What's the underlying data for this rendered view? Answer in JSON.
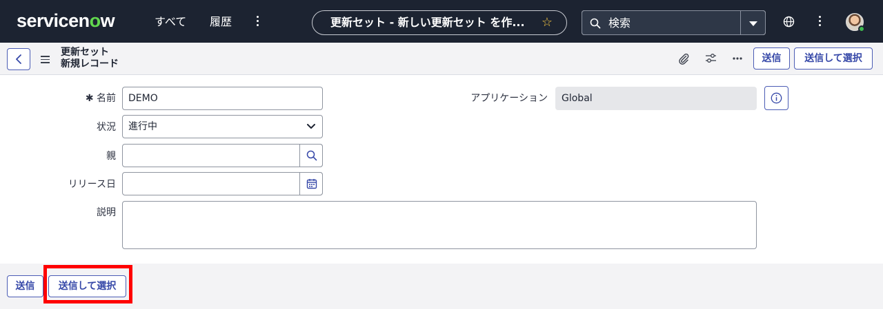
{
  "brand": {
    "pre": "servicen",
    "o": "o",
    "post": "w",
    "accent": "#62d84e"
  },
  "nav": {
    "all": "すべて",
    "history": "履歴",
    "page_title": "更新セット - 新しい更新セット を作...",
    "search_placeholder": "検索"
  },
  "header": {
    "line1": "更新セット",
    "line2": "新規レコード",
    "submit": "送信",
    "submit_select": "送信して選択"
  },
  "form": {
    "name_label": "名前",
    "name_required": "✱",
    "name_value": "DEMO",
    "state_label": "状況",
    "state_value": "進行中",
    "parent_label": "親",
    "parent_value": "",
    "release_label": "リリース日",
    "release_value": "",
    "desc_label": "説明",
    "desc_value": "",
    "app_label": "アプリケーション",
    "app_value": "Global"
  },
  "footer": {
    "submit": "送信",
    "submit_select": "送信して選択"
  },
  "colors": {
    "nav_bg": "#1c2331",
    "button_text": "#3648a8",
    "highlight": "#ff0000"
  }
}
